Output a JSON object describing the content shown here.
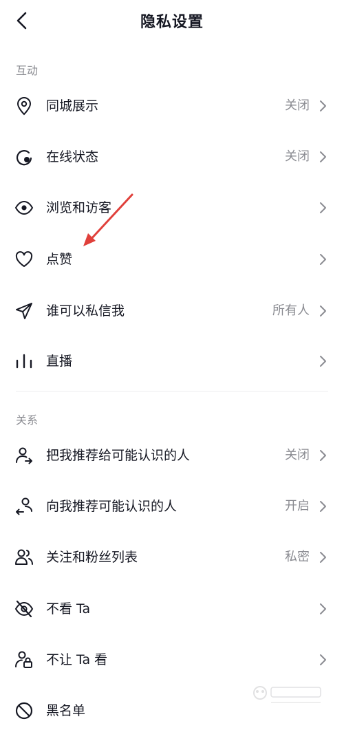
{
  "header": {
    "title": "隐私设置"
  },
  "sections": {
    "interaction": {
      "label": "互动"
    },
    "relations": {
      "label": "关系"
    }
  },
  "rows": {
    "same_city": {
      "label": "同城展示",
      "value": "关闭",
      "icon": "location-pin-icon"
    },
    "online_status": {
      "label": "在线状态",
      "value": "关闭",
      "icon": "online-status-icon"
    },
    "browse_visitors": {
      "label": "浏览和访客",
      "icon": "eye-icon"
    },
    "likes": {
      "label": "点赞",
      "icon": "heart-icon"
    },
    "direct_message": {
      "label": "谁可以私信我",
      "value": "所有人",
      "icon": "paper-plane-icon"
    },
    "live": {
      "label": "直播",
      "icon": "live-bars-icon"
    },
    "recommend_me": {
      "label": "把我推荐给可能认识的人",
      "value": "关闭",
      "icon": "user-share-icon"
    },
    "recommend_to_me": {
      "label": "向我推荐可能认识的人",
      "value": "开启",
      "icon": "user-incoming-icon"
    },
    "follow_list": {
      "label": "关注和粉丝列表",
      "value": "私密",
      "icon": "users-icon"
    },
    "hide_ta": {
      "label": "不看 Ta",
      "icon": "eye-off-icon"
    },
    "block_ta": {
      "label": "不让 Ta 看",
      "icon": "user-lock-icon"
    },
    "blacklist": {
      "label": "黑名单",
      "icon": "ban-icon"
    }
  },
  "annotation": {
    "color": "#e0403b"
  }
}
